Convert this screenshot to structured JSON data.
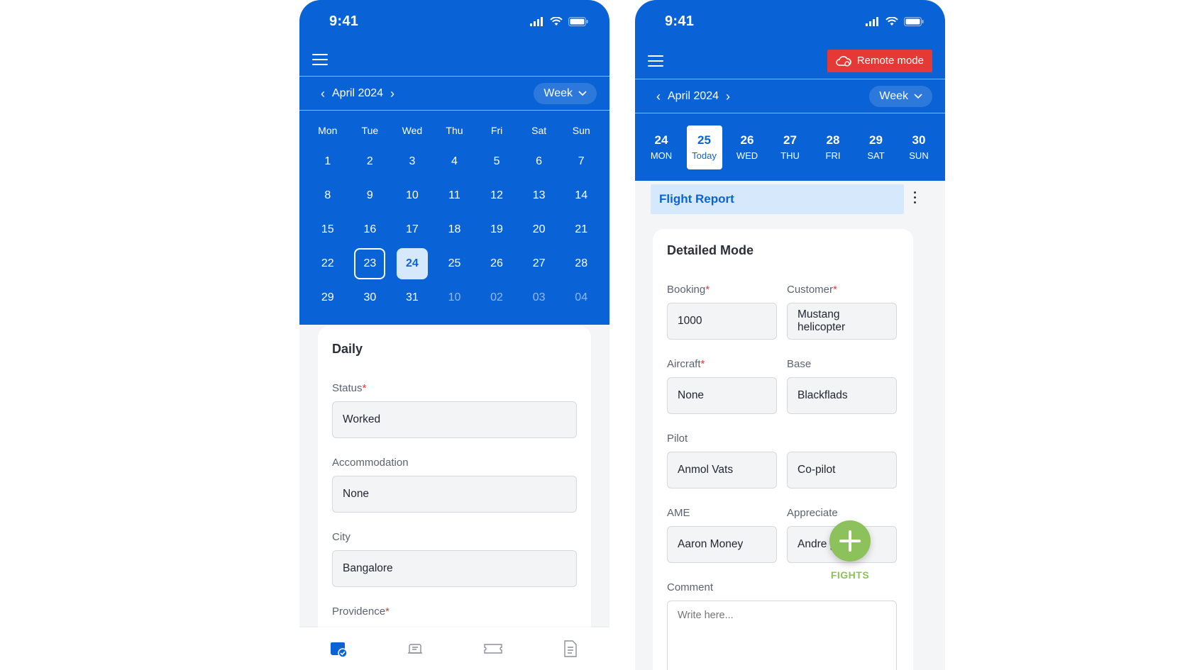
{
  "status_bar": {
    "time": "9:41"
  },
  "left": {
    "month_label": "April 2024",
    "view_label": "Week",
    "weekdays": [
      "Mon",
      "Tue",
      "Wed",
      "Thu",
      "Fri",
      "Sat",
      "Sun"
    ],
    "weeks": [
      [
        "1",
        "2",
        "3",
        "4",
        "5",
        "6",
        "7"
      ],
      [
        "8",
        "9",
        "10",
        "11",
        "12",
        "13",
        "14"
      ],
      [
        "15",
        "16",
        "17",
        "18",
        "19",
        "20",
        "21"
      ],
      [
        "22",
        "23",
        "24",
        "25",
        "26",
        "27",
        "28"
      ],
      [
        "29",
        "30",
        "31",
        "10",
        "02",
        "03",
        "04"
      ]
    ],
    "daily": {
      "title": "Daily",
      "status_label": "Status",
      "status_value": "Worked",
      "accommodation_label": "Accommodation",
      "accommodation_value": "None",
      "city_label": "City",
      "city_value": "Bangalore",
      "providence_label": "Providence"
    },
    "nav": [
      "calendar-check-icon",
      "aircraft-icon",
      "ticket-icon",
      "document-icon"
    ]
  },
  "right": {
    "remote_mode_label": "Remote mode",
    "month_label": "April 2024",
    "view_label": "Week",
    "week_days": [
      {
        "num": "24",
        "label": "MON"
      },
      {
        "num": "25",
        "label": "Today"
      },
      {
        "num": "26",
        "label": "WED"
      },
      {
        "num": "27",
        "label": "THU"
      },
      {
        "num": "28",
        "label": "FRI"
      },
      {
        "num": "29",
        "label": "SAT"
      },
      {
        "num": "30",
        "label": "SUN"
      }
    ],
    "report_title": "Flight Report",
    "detailed": {
      "title": "Detailed Mode",
      "booking_label": "Booking",
      "booking_value": "1000",
      "customer_label": "Customer",
      "customer_value": "Mustang helicopter",
      "aircraft_label": "Aircraft",
      "aircraft_value": "None",
      "base_label": "Base",
      "base_value": "Blackflads",
      "pilot_label": "Pilot",
      "pilot_value": "Anmol Vats",
      "copilot_value": "Co-pilot",
      "ame_label": "AME",
      "ame_value": "Aaron Money",
      "appreciate_label": "Appreciate",
      "appreciate_value": "Andre poissan",
      "comment_label": "Comment",
      "comment_placeholder": "Write here..."
    },
    "fab_label": "FIGHTS"
  },
  "colors": {
    "primary": "#0a63d6",
    "danger": "#e53935",
    "fab": "#8dc15b"
  }
}
